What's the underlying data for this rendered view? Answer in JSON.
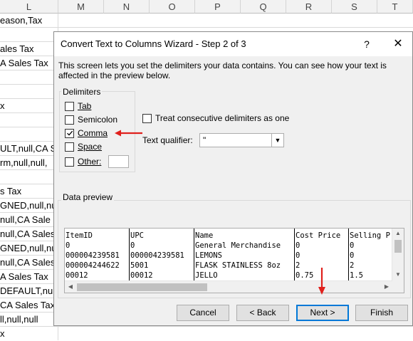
{
  "sheet": {
    "columns": [
      "L",
      "M",
      "N",
      "O",
      "P",
      "Q",
      "R",
      "S",
      "T"
    ],
    "cells": [
      "eason,Tax",
      "",
      "",
      "ales Tax",
      "A Sales Tax",
      "",
      "",
      "x",
      "",
      "",
      "ULT,null,CA S",
      "rm,null,null,",
      "",
      "s Tax",
      "GNED,null,nul",
      "null,CA Sale",
      "null,CA Sales",
      "GNED,null,nu",
      "null,CA Sales",
      "A Sales Tax",
      "DEFAULT,null",
      "CA Sales Tax",
      "ll,null,null",
      "x"
    ]
  },
  "dialog": {
    "title": "Convert Text to Columns Wizard - Step 2 of 3",
    "help_label": "?",
    "close_label": "✕",
    "description": "This screen lets you set the delimiters your data contains.  You can see how your text is affected in the preview below.",
    "delimiters": {
      "group_label": "Delimiters",
      "tab": {
        "label": "Tab",
        "checked": false
      },
      "semicolon": {
        "label": "Semicolon",
        "checked": false
      },
      "comma": {
        "label": "Comma",
        "checked": true
      },
      "space": {
        "label": "Space",
        "checked": false
      },
      "other": {
        "label": "Other:",
        "checked": false,
        "value": ""
      }
    },
    "consecutive": {
      "label": "Treat consecutive delimiters as one",
      "checked": false
    },
    "qualifier": {
      "label": "Text qualifier:",
      "value": "\""
    },
    "preview": {
      "group_label": "Data preview",
      "headers": [
        "ItemID",
        "UPC",
        "Name",
        "Cost Price",
        "Selling P"
      ],
      "rows": [
        [
          "0",
          "0",
          "General Merchandise",
          "0",
          "0"
        ],
        [
          "000004239581",
          "000004239581",
          "LEMONS",
          "0",
          "0"
        ],
        [
          "000004244622",
          "5001",
          "FLASK STAINLESS 8oz",
          "2",
          "2"
        ],
        [
          "00012",
          "00012",
          "JELLO",
          "0.75",
          "1.5"
        ]
      ]
    },
    "buttons": {
      "cancel": "Cancel",
      "back": "< Back",
      "next": "Next >",
      "finish": "Finish"
    }
  },
  "colors": {
    "annotation_red": "#e0201c",
    "default_button_border": "#0078d7"
  }
}
